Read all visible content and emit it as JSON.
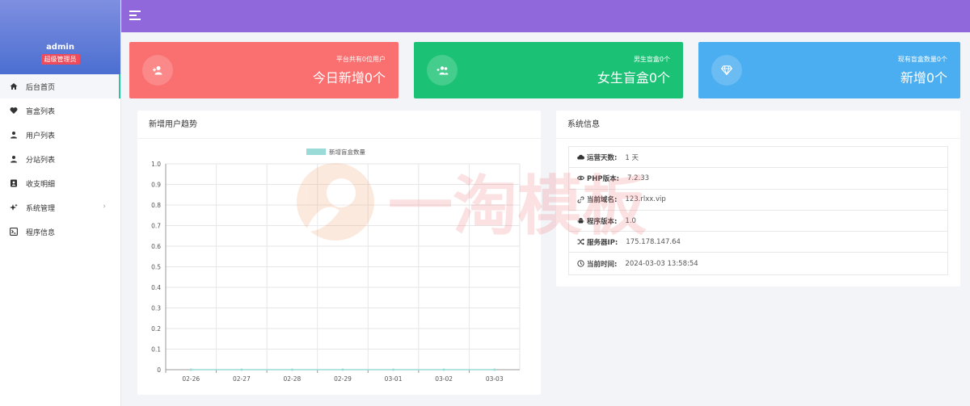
{
  "sidebar": {
    "user": {
      "name": "admin",
      "role": "超级管理员"
    },
    "items": [
      {
        "label": "后台首页",
        "icon": "home-icon",
        "active": true
      },
      {
        "label": "盲盒列表",
        "icon": "heart-icon"
      },
      {
        "label": "用户列表",
        "icon": "user-icon"
      },
      {
        "label": "分站列表",
        "icon": "user-icon"
      },
      {
        "label": "收支明细",
        "icon": "contact-card-icon"
      },
      {
        "label": "系统管理",
        "icon": "sparkle-icon",
        "has_children": true
      },
      {
        "label": "程序信息",
        "icon": "terminal-icon"
      }
    ]
  },
  "header": {
    "menu_icon": "hamburger-icon",
    "color": "#9168dc"
  },
  "stats": [
    {
      "small": "平台共有0位用户",
      "big": "今日新增0个",
      "color": "#fa6f6f",
      "icon": "user-plus-icon"
    },
    {
      "small": "男生盲盒0个",
      "big": "女生盲盒0个",
      "color": "#1bc275",
      "icon": "users-plus-icon"
    },
    {
      "small": "现有盲盒数量0个",
      "big": "新增0个",
      "color": "#4aaef0",
      "icon": "diamond-icon"
    }
  ],
  "chart_panel": {
    "title": "新增用户趋势"
  },
  "chart_data": {
    "type": "line",
    "categories": [
      "02-26",
      "02-27",
      "02-28",
      "02-29",
      "03-01",
      "03-02",
      "03-03"
    ],
    "series": [
      {
        "name": "新增盲盒数量",
        "values": [
          0,
          0,
          0,
          0,
          0,
          0,
          0
        ],
        "color": "#9adbd8"
      }
    ],
    "ylim": [
      0,
      1.0
    ],
    "yticks": [
      "0",
      "0.1",
      "0.2",
      "0.3",
      "0.4",
      "0.5",
      "0.6",
      "0.7",
      "0.8",
      "0.9",
      "1.0"
    ],
    "grid": true,
    "legend": "top-center"
  },
  "info_panel": {
    "title": "系统信息",
    "rows": [
      {
        "label": "运营天数:",
        "value": "1 天",
        "icon": "cloud-icon"
      },
      {
        "label": "PHP版本:",
        "value": "7.2.33",
        "icon": "eye-icon"
      },
      {
        "label": "当前域名:",
        "value": "123.rlxx.vip",
        "icon": "link-icon"
      },
      {
        "label": "程序版本:",
        "value": "1.0",
        "icon": "android-icon"
      },
      {
        "label": "服务器IP:",
        "value": "175.178.147.64",
        "icon": "shuffle-icon"
      },
      {
        "label": "当前时间:",
        "value": "2024-03-03 13:58:54",
        "icon": "clock-icon"
      }
    ]
  },
  "watermark": {
    "text": "一淘模板",
    "icon": "watermark-logo-icon"
  }
}
